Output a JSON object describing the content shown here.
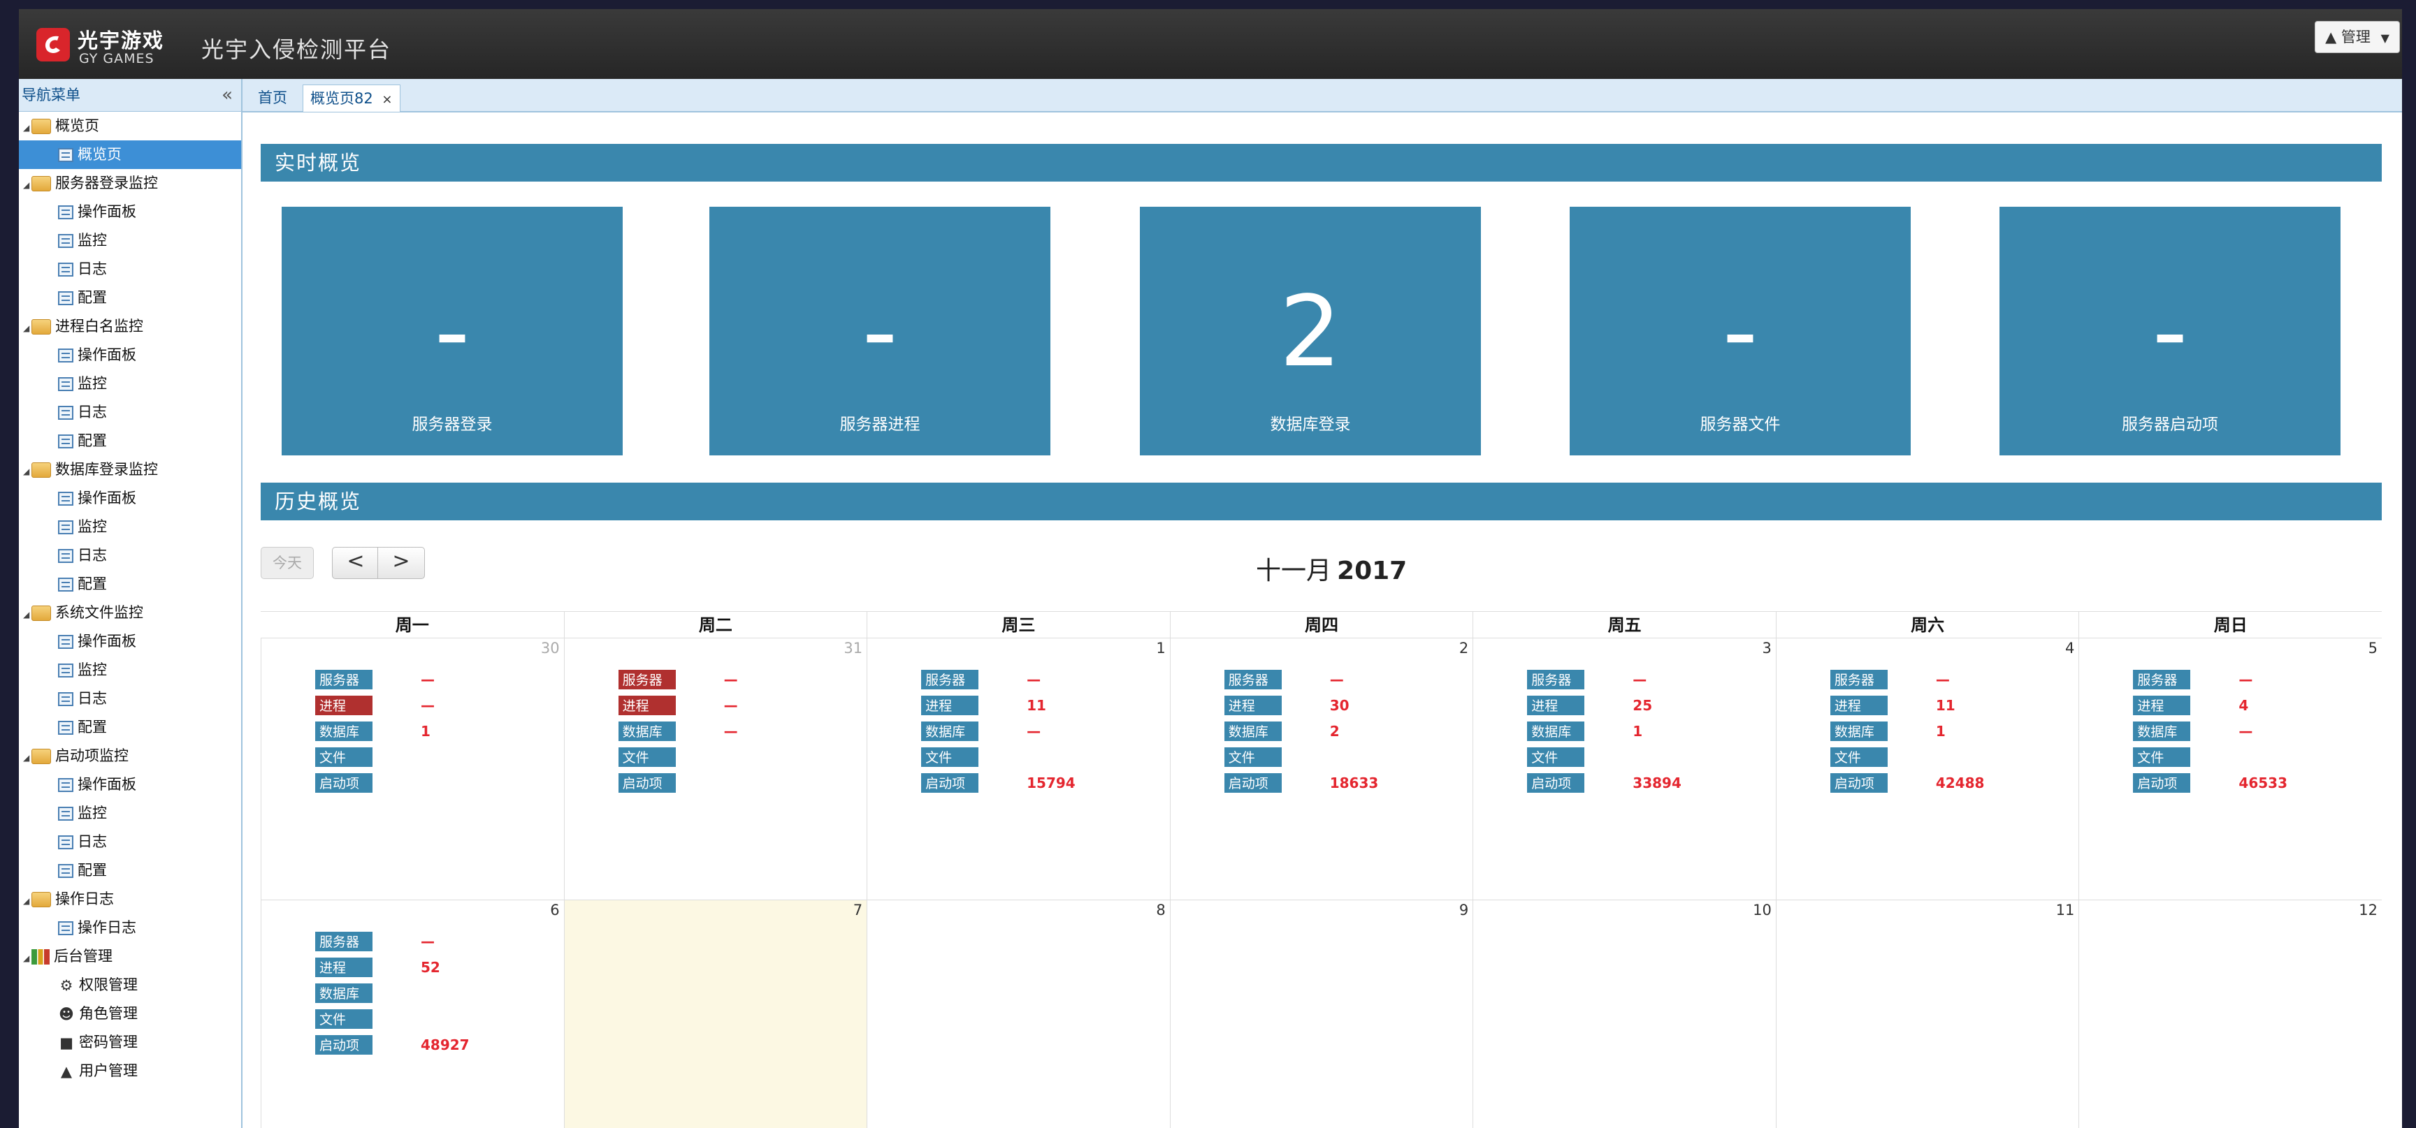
{
  "header": {
    "logo_cn": "光宇游戏",
    "logo_en": "GY GAMES",
    "platform_title": "光宇入侵检测平台",
    "user_label": "管理"
  },
  "sidebar": {
    "title": "导航菜单",
    "collapse_glyph": "«",
    "items": [
      {
        "label": "概览页",
        "level": "parent",
        "icon": "folder-icon"
      },
      {
        "label": "概览页",
        "level": "child",
        "icon": "page-icon",
        "active": true
      },
      {
        "label": "服务器登录监控",
        "level": "parent",
        "icon": "folder-icon"
      },
      {
        "label": "操作面板",
        "level": "child",
        "icon": "page-icon"
      },
      {
        "label": "监控",
        "level": "child",
        "icon": "page-icon"
      },
      {
        "label": "日志",
        "level": "child",
        "icon": "page-icon"
      },
      {
        "label": "配置",
        "level": "child",
        "icon": "page-icon"
      },
      {
        "label": "进程白名监控",
        "level": "parent",
        "icon": "folder-icon"
      },
      {
        "label": "操作面板",
        "level": "child",
        "icon": "page-icon"
      },
      {
        "label": "监控",
        "level": "child",
        "icon": "page-icon"
      },
      {
        "label": "日志",
        "level": "child",
        "icon": "page-icon"
      },
      {
        "label": "配置",
        "level": "child",
        "icon": "page-icon"
      },
      {
        "label": "数据库登录监控",
        "level": "parent",
        "icon": "folder-icon"
      },
      {
        "label": "操作面板",
        "level": "child",
        "icon": "page-icon"
      },
      {
        "label": "监控",
        "level": "child",
        "icon": "page-icon"
      },
      {
        "label": "日志",
        "level": "child",
        "icon": "page-icon"
      },
      {
        "label": "配置",
        "level": "child",
        "icon": "page-icon"
      },
      {
        "label": "系统文件监控",
        "level": "parent",
        "icon": "folder-icon"
      },
      {
        "label": "操作面板",
        "level": "child",
        "icon": "page-icon"
      },
      {
        "label": "监控",
        "level": "child",
        "icon": "page-icon"
      },
      {
        "label": "日志",
        "level": "child",
        "icon": "page-icon"
      },
      {
        "label": "配置",
        "level": "child",
        "icon": "page-icon"
      },
      {
        "label": "启动项监控",
        "level": "parent",
        "icon": "folder-icon"
      },
      {
        "label": "操作面板",
        "level": "child",
        "icon": "page-icon"
      },
      {
        "label": "监控",
        "level": "child",
        "icon": "page-icon"
      },
      {
        "label": "日志",
        "level": "child",
        "icon": "page-icon"
      },
      {
        "label": "配置",
        "level": "child",
        "icon": "page-icon"
      },
      {
        "label": "操作日志",
        "level": "parent",
        "icon": "folder-icon"
      },
      {
        "label": "操作日志",
        "level": "child",
        "icon": "page-icon"
      },
      {
        "label": "后台管理",
        "level": "parent",
        "icon": "chart-icon"
      },
      {
        "label": "权限管理",
        "level": "child",
        "icon": "gear-icon"
      },
      {
        "label": "角色管理",
        "level": "child",
        "icon": "users-icon"
      },
      {
        "label": "密码管理",
        "level": "child",
        "icon": "lock-icon"
      },
      {
        "label": "用户管理",
        "level": "child",
        "icon": "user-icon"
      }
    ]
  },
  "tabs": [
    {
      "label": "首页",
      "active": false
    },
    {
      "label": "概览页82",
      "active": true,
      "close": "×"
    }
  ],
  "realtime": {
    "title": "实时概览",
    "tiles": [
      {
        "value": "-",
        "label": "服务器登录"
      },
      {
        "value": "-",
        "label": "服务器进程"
      },
      {
        "value": "2",
        "label": "数据库登录"
      },
      {
        "value": "-",
        "label": "服务器文件"
      },
      {
        "value": "-",
        "label": "服务器启动项"
      }
    ]
  },
  "history": {
    "title": "历史概览",
    "today_btn": "今天",
    "prev_btn": "<",
    "next_btn": ">",
    "month_label": "十一月",
    "year_label": "2017"
  },
  "calendar": {
    "weekdays": [
      "周一",
      "周二",
      "周三",
      "周四",
      "周五",
      "周六",
      "周日"
    ],
    "weeks": [
      [
        {
          "day": "30",
          "other": true,
          "events": [
            {
              "tag": "服务器",
              "value": "—",
              "alert": false
            },
            {
              "tag": "进程",
              "value": "—",
              "alert": true
            },
            {
              "tag": "数据库",
              "value": "1",
              "alert": false
            },
            {
              "tag": "文件",
              "value": "",
              "alert": false
            },
            {
              "tag": "启动项",
              "value": "",
              "alert": false
            }
          ]
        },
        {
          "day": "31",
          "other": true,
          "events": [
            {
              "tag": "服务器",
              "value": "—",
              "alert": true
            },
            {
              "tag": "进程",
              "value": "—",
              "alert": true
            },
            {
              "tag": "数据库",
              "value": "—",
              "alert": false
            },
            {
              "tag": "文件",
              "value": "",
              "alert": false
            },
            {
              "tag": "启动项",
              "value": "",
              "alert": false
            }
          ]
        },
        {
          "day": "1",
          "other": false,
          "events": [
            {
              "tag": "服务器",
              "value": "—",
              "alert": false
            },
            {
              "tag": "进程",
              "value": "11",
              "alert": false
            },
            {
              "tag": "数据库",
              "value": "—",
              "alert": false
            },
            {
              "tag": "文件",
              "value": "",
              "alert": false
            },
            {
              "tag": "启动项",
              "value": "15794",
              "alert": false
            }
          ]
        },
        {
          "day": "2",
          "other": false,
          "events": [
            {
              "tag": "服务器",
              "value": "—",
              "alert": false
            },
            {
              "tag": "进程",
              "value": "30",
              "alert": false
            },
            {
              "tag": "数据库",
              "value": "2",
              "alert": false
            },
            {
              "tag": "文件",
              "value": "",
              "alert": false
            },
            {
              "tag": "启动项",
              "value": "18633",
              "alert": false
            }
          ]
        },
        {
          "day": "3",
          "other": false,
          "events": [
            {
              "tag": "服务器",
              "value": "—",
              "alert": false
            },
            {
              "tag": "进程",
              "value": "25",
              "alert": false
            },
            {
              "tag": "数据库",
              "value": "1",
              "alert": false
            },
            {
              "tag": "文件",
              "value": "",
              "alert": false
            },
            {
              "tag": "启动项",
              "value": "33894",
              "alert": false
            }
          ]
        },
        {
          "day": "4",
          "other": false,
          "events": [
            {
              "tag": "服务器",
              "value": "—",
              "alert": false
            },
            {
              "tag": "进程",
              "value": "11",
              "alert": false
            },
            {
              "tag": "数据库",
              "value": "1",
              "alert": false
            },
            {
              "tag": "文件",
              "value": "",
              "alert": false
            },
            {
              "tag": "启动项",
              "value": "42488",
              "alert": false
            }
          ]
        },
        {
          "day": "5",
          "other": false,
          "events": [
            {
              "tag": "服务器",
              "value": "—",
              "alert": false
            },
            {
              "tag": "进程",
              "value": "4",
              "alert": false
            },
            {
              "tag": "数据库",
              "value": "—",
              "alert": false
            },
            {
              "tag": "文件",
              "value": "",
              "alert": false
            },
            {
              "tag": "启动项",
              "value": "46533",
              "alert": false
            }
          ]
        }
      ],
      [
        {
          "day": "6",
          "other": false,
          "events": [
            {
              "tag": "服务器",
              "value": "—",
              "alert": false
            },
            {
              "tag": "进程",
              "value": "52",
              "alert": false
            },
            {
              "tag": "数据库",
              "value": "",
              "alert": false
            },
            {
              "tag": "文件",
              "value": "",
              "alert": false
            },
            {
              "tag": "启动项",
              "value": "48927",
              "alert": false
            }
          ]
        },
        {
          "day": "7",
          "other": false,
          "today": true,
          "events": []
        },
        {
          "day": "8",
          "other": false,
          "events": []
        },
        {
          "day": "9",
          "other": false,
          "events": []
        },
        {
          "day": "10",
          "other": false,
          "events": []
        },
        {
          "day": "11",
          "other": false,
          "events": []
        },
        {
          "day": "12",
          "other": false,
          "events": []
        }
      ]
    ]
  },
  "colors": {
    "accent": "#3a87ad",
    "alert": "#b0302f",
    "value_red": "#e4262f",
    "today": "#fcf8e3",
    "active_nav": "#3d8fd6"
  }
}
